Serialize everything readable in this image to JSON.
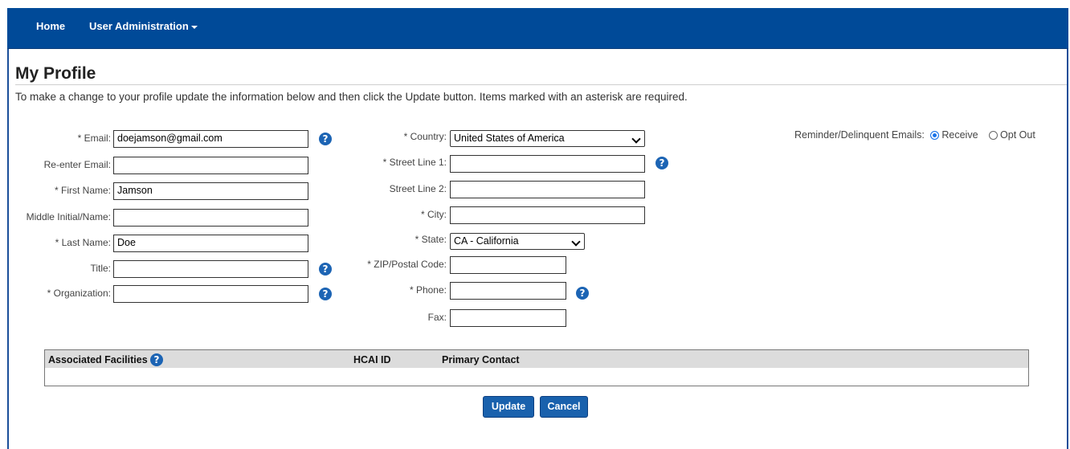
{
  "nav": {
    "home": "Home",
    "user_admin": "User Administration"
  },
  "page": {
    "title": "My Profile",
    "intro": "To make a change to your profile update the information below and then click the Update button. Items marked with an asterisk are required."
  },
  "help_glyph": "?",
  "left_fields": {
    "email": {
      "label": "* Email:",
      "value": "doejamson@gmail.com"
    },
    "reenter_email": {
      "label": "Re-enter Email:",
      "value": ""
    },
    "first_name": {
      "label": "* First Name:",
      "value": "Jamson"
    },
    "middle": {
      "label": "Middle Initial/Name:",
      "value": ""
    },
    "last_name": {
      "label": "* Last Name:",
      "value": "Doe"
    },
    "title": {
      "label": "Title:",
      "value": ""
    },
    "organization": {
      "label": "* Organization:",
      "value": ""
    }
  },
  "right_fields": {
    "country": {
      "label": "* Country:",
      "value": "United States of America"
    },
    "street1": {
      "label": "* Street Line 1:",
      "value": ""
    },
    "street2": {
      "label": "Street Line 2:",
      "value": ""
    },
    "city": {
      "label": "* City:",
      "value": ""
    },
    "state": {
      "label": "* State:",
      "value": "CA - California"
    },
    "zip": {
      "label": "* ZIP/Postal Code:",
      "value": ""
    },
    "phone": {
      "label": "* Phone:",
      "value": ""
    },
    "fax": {
      "label": "Fax:",
      "value": ""
    }
  },
  "reminder": {
    "label": "Reminder/Delinquent Emails:",
    "options": [
      "Receive",
      "Opt Out"
    ],
    "selected": "Receive"
  },
  "facilities_table": {
    "columns": [
      "Associated Facilities",
      "HCAI ID",
      "Primary Contact"
    ],
    "rows": []
  },
  "buttons": {
    "update": "Update",
    "cancel": "Cancel"
  },
  "colors": {
    "navbar": "#004a98",
    "button": "#1961ad",
    "help_icon": "#1c64b4"
  }
}
